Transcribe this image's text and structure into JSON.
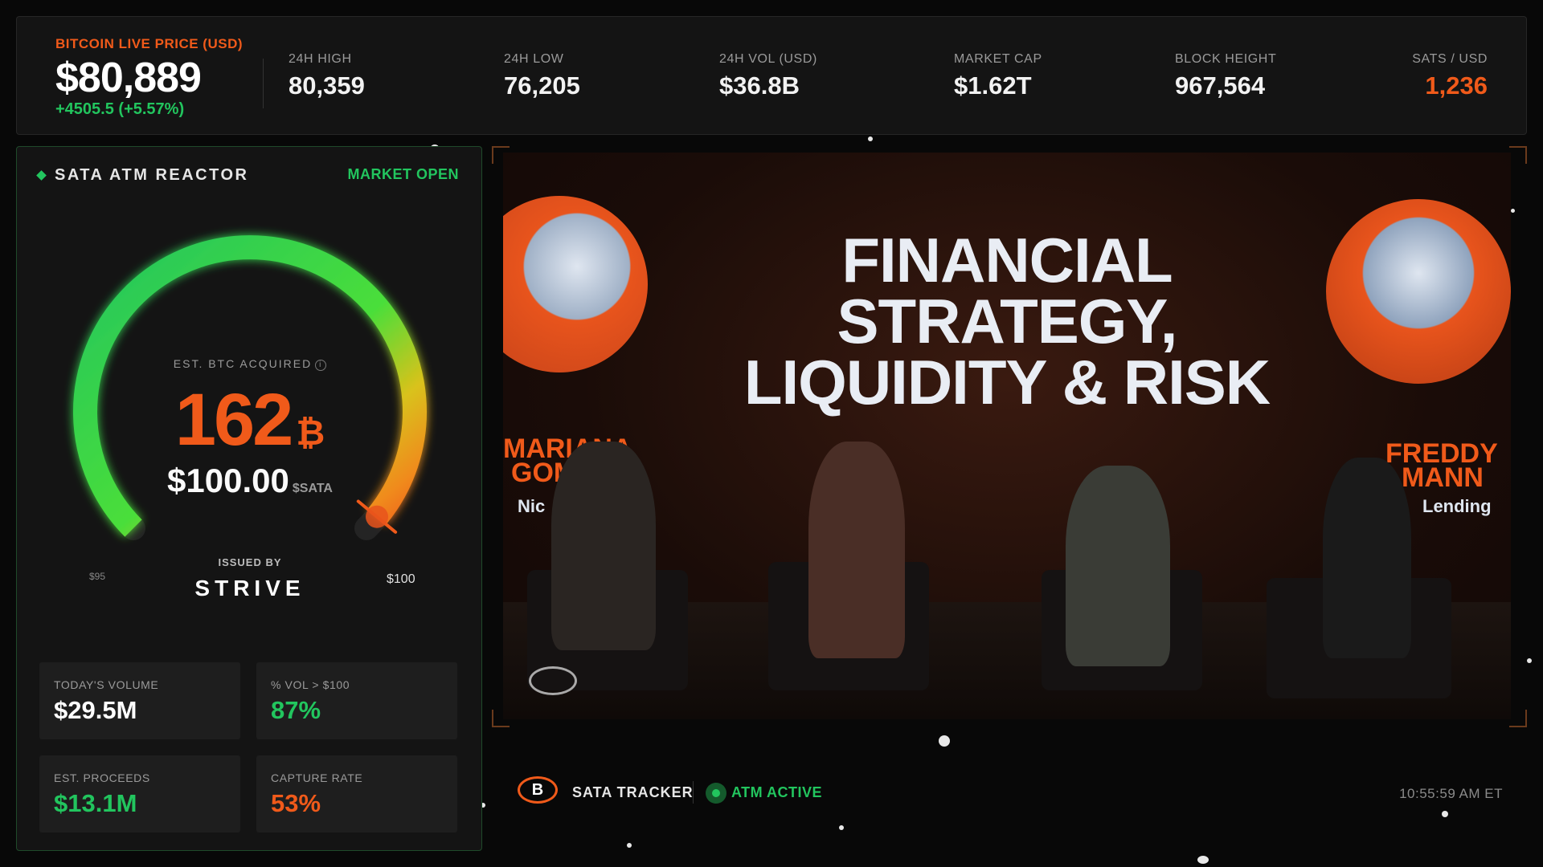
{
  "ticker": {
    "btc_label": "BITCOIN LIVE PRICE (USD)",
    "btc_price": "$80,889",
    "btc_change": "+4505.5 (+5.57%)",
    "stats": [
      {
        "label": "24H HIGH",
        "value": "80,359"
      },
      {
        "label": "24H LOW",
        "value": "76,205"
      },
      {
        "label": "24H VOL (USD)",
        "value": "$36.8B"
      },
      {
        "label": "MARKET CAP",
        "value": "$1.62T"
      },
      {
        "label": "BLOCK HEIGHT",
        "value": "967,564"
      },
      {
        "label": "SATS / USD",
        "value": "1,236"
      }
    ]
  },
  "reactor": {
    "title": "SATA ATM REACTOR",
    "status": "MARKET OPEN",
    "gauge_level": 0.98,
    "est_label": "EST. BTC ACQUIRED",
    "info_icon": "i",
    "btc_acquired": "162",
    "btc_symbol": "₿",
    "price": "$100.00",
    "price_unit": "$SATA",
    "tick_low": "$95",
    "tick_high": "$100",
    "issued_by": "ISSUED BY",
    "issuer": "STRIVE",
    "cards": [
      {
        "label": "TODAY'S VOLUME",
        "value": "$29.5M",
        "color": "#ffffff"
      },
      {
        "label": "% VOL > $100",
        "value": "87%",
        "color": "#22c55e"
      },
      {
        "label": "EST. PROCEEDS",
        "value": "$13.1M",
        "color": "#22c55e"
      },
      {
        "label": "CAPTURE RATE",
        "value": "53%",
        "color": "#f05a1a"
      }
    ]
  },
  "video": {
    "headline_1": "FINANCIAL",
    "headline_2": "STRATEGY,",
    "headline_3": "LIQUIDITY & RISK",
    "left_name_1": "MARIANA",
    "left_name_2": "GOMB",
    "left_sub": "Nic",
    "right_name_1": "FREDDY",
    "right_name_2": "MANN",
    "right_sub": "Lending"
  },
  "bottom": {
    "logo_letter": "B",
    "title": "SATA TRACKER",
    "atm_status": "ATM ACTIVE",
    "clock": "10:55:59 AM ET"
  },
  "colors": {
    "accent_orange": "#f05a1a",
    "accent_green": "#22c55e",
    "panel_bg": "#141414"
  }
}
